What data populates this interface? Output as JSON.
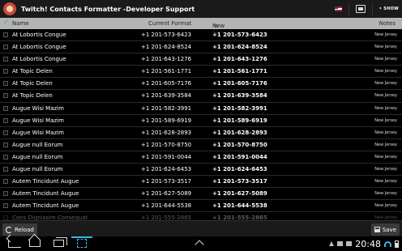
{
  "app": {
    "title": "Twitch! Contacts Formatter -Developer Support",
    "show_label": "• SHOW"
  },
  "header": {
    "name": "Name",
    "current_format": "Current Format",
    "new_format": "New Format",
    "notes": "Notes"
  },
  "rows": [
    {
      "name": "At Lobortis Congue",
      "current": "+1 201-573-6423",
      "new": "+1 201-573-6423",
      "note": "New Jersey"
    },
    {
      "name": "At Lobortis Congue",
      "current": "+1 201-624-8524",
      "new": "+1 201-624-8524",
      "note": "New Jersey"
    },
    {
      "name": "At Lobortis Congue",
      "current": "+1 201-643-1276",
      "new": "+1 201-643-1276",
      "note": "New Jersey"
    },
    {
      "name": "At Topic Delen",
      "current": "+1 201-561-1771",
      "new": "+1 201-561-1771",
      "note": "New Jersey"
    },
    {
      "name": "At Topic Delen",
      "current": "+1 201-605-7176",
      "new": "+1 201-605-7176",
      "note": "New Jersey"
    },
    {
      "name": "At Topic Delen",
      "current": "+1 201-639-3584",
      "new": "+1 201-639-3584",
      "note": "New Jersey"
    },
    {
      "name": "Augue Wisi Mazim",
      "current": "+1 201-582-3991",
      "new": "+1 201-582-3991",
      "note": "New Jersey"
    },
    {
      "name": "Augue Wisi Mazim",
      "current": "+1 201-589-6919",
      "new": "+1 201-589-6919",
      "note": "New Jersey"
    },
    {
      "name": "Augue Wisi Mazim",
      "current": "+1 201-628-2893",
      "new": "+1 201-628-2893",
      "note": "New Jersey"
    },
    {
      "name": "Augue null Eorum",
      "current": "+1 201-570-8750",
      "new": "+1 201-570-8750",
      "note": "New Jersey"
    },
    {
      "name": "Augue null Eorum",
      "current": "+1 201-591-0044",
      "new": "+1 201-591-0044",
      "note": "New Jersey"
    },
    {
      "name": "Augue null Eorum",
      "current": "+1 201-624-6453",
      "new": "+1 201-624-6453",
      "note": "New Jersey"
    },
    {
      "name": "Autem Tincidunt Augue",
      "current": "+1 201-573-3517",
      "new": "+1 201-573-3517",
      "note": "New Jersey"
    },
    {
      "name": "Autem Tincidunt Augue",
      "current": "+1 201-627-5089",
      "new": "+1 201-627-5089",
      "note": "New Jersey"
    },
    {
      "name": "Autem Tincidunt Augue",
      "current": "+1 201-644-5538",
      "new": "+1 201-644-5538",
      "note": "New Jersey"
    },
    {
      "name": "Cons Dignissim Consequat",
      "current": "+1 201-555-2865",
      "new": "+1 201-555-2865",
      "note": "New Jersey"
    }
  ],
  "actions": {
    "reload": "Reload",
    "save": "Save"
  },
  "status": {
    "clock": "20:48"
  }
}
